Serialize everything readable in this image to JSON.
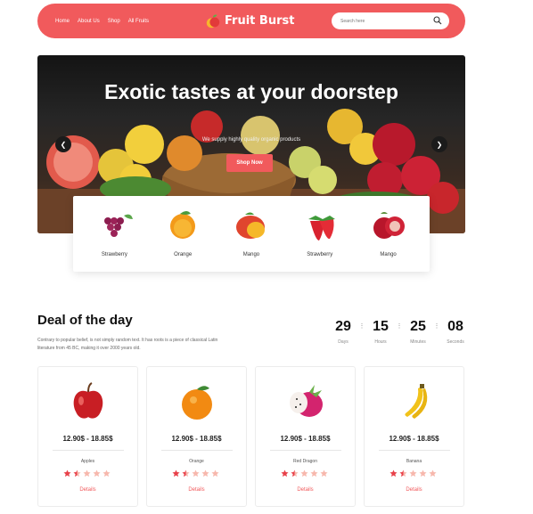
{
  "nav": {
    "links": [
      "Home",
      "About Us",
      "Shop",
      "All Fruits"
    ],
    "brand": "Fruit Burst",
    "search_placeholder": "Search here",
    "accent": "#f15a5c"
  },
  "hero": {
    "title": "Exotic tastes at your doorstep",
    "subtitle": "We supply highly quality organic products",
    "cta": "Shop Now",
    "prev_icon": "chevron-left-icon",
    "next_icon": "chevron-right-icon"
  },
  "categories": [
    {
      "label": "Strawberry",
      "icon": "grapes"
    },
    {
      "label": "Orange",
      "icon": "orange"
    },
    {
      "label": "Mango",
      "icon": "mango"
    },
    {
      "label": "Strawberry",
      "icon": "strawberry"
    },
    {
      "label": "Mango",
      "icon": "pomegranate"
    }
  ],
  "deal": {
    "title": "Deal of the day",
    "description": "Contrary to popular belief, is not simply random text. It has roots is a piece of classical Latin literature from 45 BC, making it over 2000 years old.",
    "countdown": [
      {
        "value": "29",
        "label": "Days"
      },
      {
        "value": "15",
        "label": "Hours"
      },
      {
        "value": "25",
        "label": "Minutes"
      },
      {
        "value": "08",
        "label": "Seconds"
      }
    ]
  },
  "products": [
    {
      "name": "Apples",
      "price": "12.90$ - 18.85$",
      "rating": 1.5,
      "details": "Details",
      "icon": "apple"
    },
    {
      "name": "Orange",
      "price": "12.90$ - 18.85$",
      "rating": 1.5,
      "details": "Details",
      "icon": "orange"
    },
    {
      "name": "Red Dragon",
      "price": "12.90$ - 18.85$",
      "rating": 1.5,
      "details": "Details",
      "icon": "dragon-fruit"
    },
    {
      "name": "Banana",
      "price": "12.90$ - 18.85$",
      "rating": 1.5,
      "details": "Details",
      "icon": "banana"
    }
  ]
}
